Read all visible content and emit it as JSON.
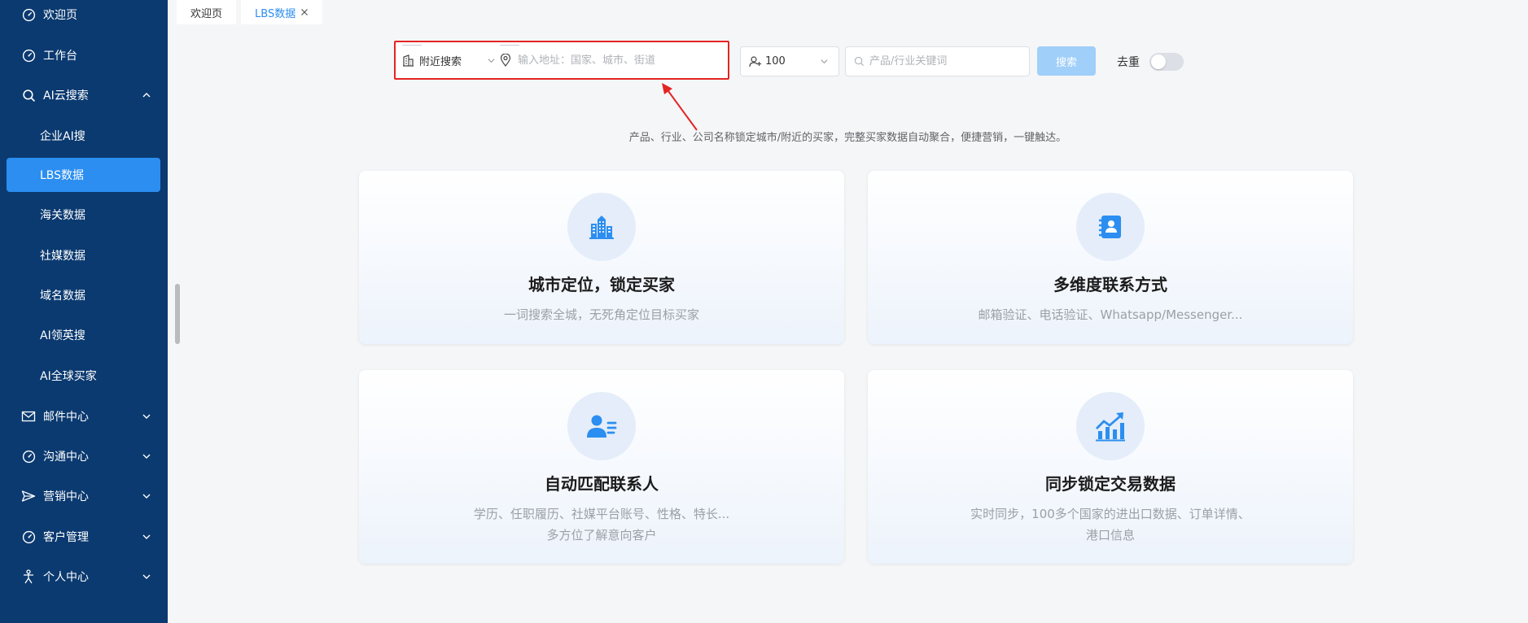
{
  "sidebar": {
    "items": [
      {
        "label": "欢迎页",
        "icon": "gauge-icon"
      },
      {
        "label": "工作台",
        "icon": "gauge-icon"
      },
      {
        "label": "AI云搜索",
        "icon": "search-icon",
        "expanded": true
      },
      {
        "label": "邮件中心",
        "icon": "mail-icon"
      },
      {
        "label": "沟通中心",
        "icon": "gauge-icon"
      },
      {
        "label": "营销中心",
        "icon": "send-icon"
      },
      {
        "label": "客户管理",
        "icon": "gauge-icon"
      },
      {
        "label": "个人中心",
        "icon": "person-icon"
      }
    ],
    "sub_items": [
      "企业AI搜",
      "LBS数据",
      "海关数据",
      "社媒数据",
      "域名数据",
      "AI领英搜",
      "AI全球买家"
    ],
    "active_sub": "LBS数据"
  },
  "tabs": [
    {
      "label": "欢迎页"
    },
    {
      "label": "LBS数据",
      "active": true
    }
  ],
  "search": {
    "mode_label": "附近搜索",
    "address_placeholder": "输入地址：国家、城市、街道",
    "count_value": "100",
    "keyword_placeholder": "产品/行业关键词",
    "search_label": "搜索",
    "dedupe_label": "去重",
    "dedupe_on": false
  },
  "tagline": "产品、行业、公司名称锁定城市/附近的买家，完整买家数据自动聚合，便捷营销，一键触达。",
  "cards": [
    {
      "title": "城市定位，锁定买家",
      "desc": [
        "一词搜索全城，无死角定位目标买家"
      ],
      "icon": "buildings-icon"
    },
    {
      "title": "多维度联系方式",
      "desc": [
        "邮箱验证、电话验证、Whatsapp/Messenger..."
      ],
      "icon": "contact-book-icon"
    },
    {
      "title": "自动匹配联系人",
      "desc": [
        "学历、任职履历、社媒平台账号、性格、特长...",
        "多方位了解意向客户"
      ],
      "icon": "user-list-icon"
    },
    {
      "title": "同步锁定交易数据",
      "desc": [
        "实时同步，100多个国家的进出口数据、订单详情、",
        "港口信息"
      ],
      "icon": "chart-growth-icon"
    }
  ],
  "colors": {
    "sidebar_bg": "#0b3a70",
    "accent": "#2b8ef0",
    "highlight_border": "#e42424",
    "search_btn": "#a0cff9"
  }
}
